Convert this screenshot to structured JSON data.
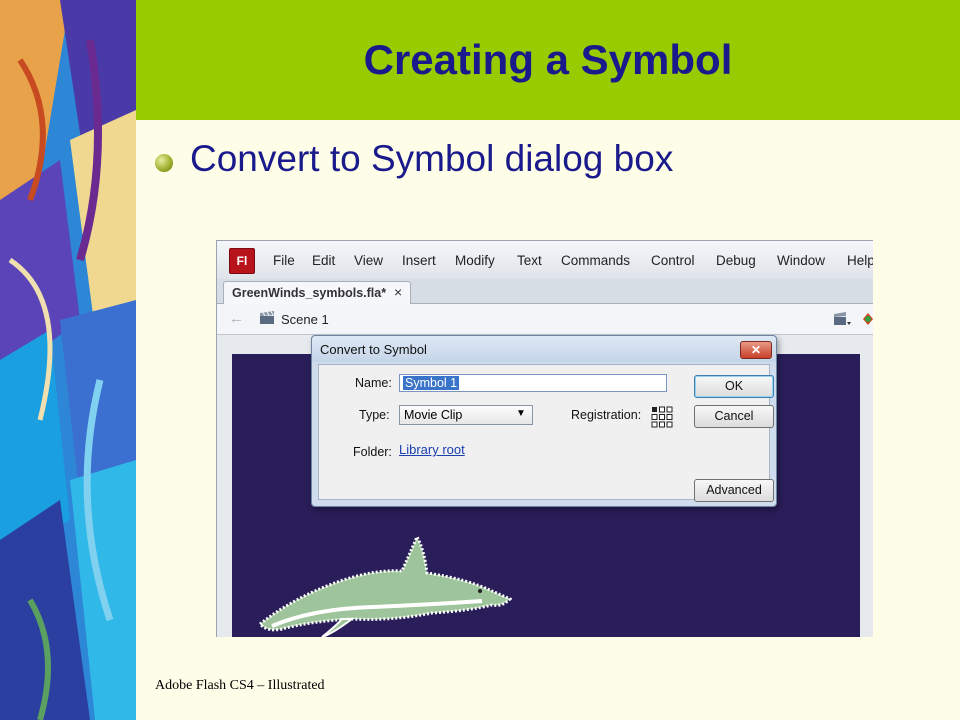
{
  "slide": {
    "title": "Creating a Symbol",
    "bullet": "Convert to Symbol dialog box",
    "footer": "Adobe Flash CS4 – Illustrated"
  },
  "app": {
    "logo": "Fl",
    "menu": [
      "File",
      "Edit",
      "View",
      "Insert",
      "Modify",
      "Text",
      "Commands",
      "Control",
      "Debug",
      "Window",
      "Help"
    ],
    "document_tab": "GreenWinds_symbols.fla*",
    "tab_close": "×",
    "scene": "Scene 1"
  },
  "dialog": {
    "title": "Convert to Symbol",
    "close_glyph": "✕",
    "name_label": "Name:",
    "name_value": "Symbol 1",
    "type_label": "Type:",
    "type_value": "Movie Clip",
    "registration_label": "Registration:",
    "folder_label": "Folder:",
    "folder_value": "Library root",
    "ok": "OK",
    "cancel": "Cancel",
    "advanced": "Advanced"
  },
  "colors": {
    "title_banner": "#99cc00",
    "title_text": "#1a1a8c",
    "stage": "#2a1e5a",
    "dolphin": "#9dc49a"
  }
}
